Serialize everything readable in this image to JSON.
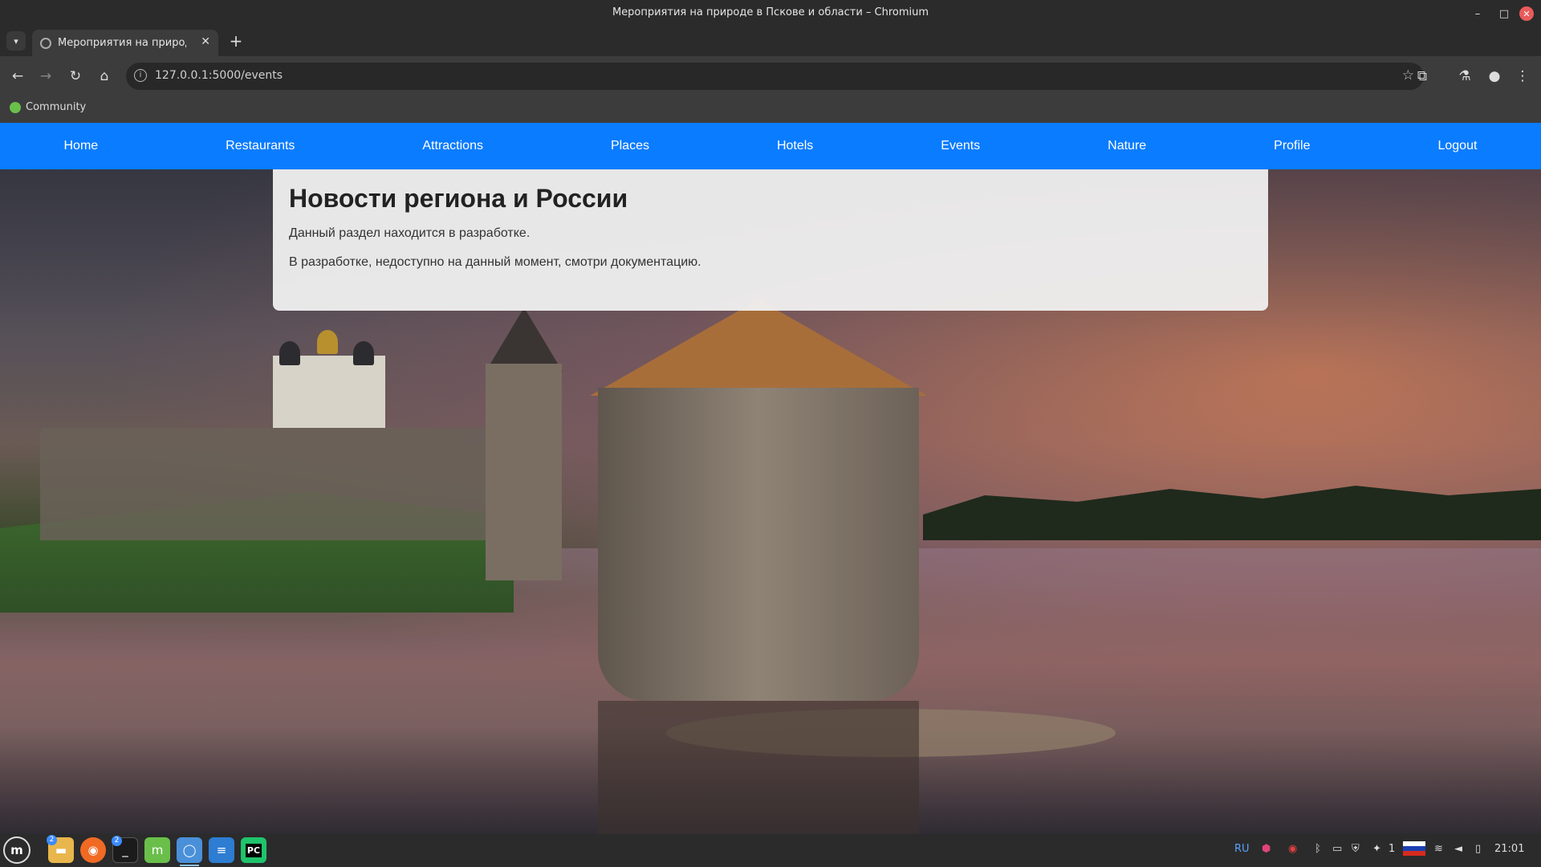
{
  "window": {
    "title": "Мероприятия на природе в Пскове и области – Chromium",
    "minimize": "–",
    "maximize": "□",
    "close": "✕"
  },
  "tabs": [
    {
      "title": "Мероприятия на природе в Пскове и области",
      "close": "✕"
    }
  ],
  "toolbar": {
    "url": "127.0.0.1:5000/events"
  },
  "bookmarks": [
    {
      "label": "Community"
    }
  ],
  "site_nav": {
    "items": [
      "Home",
      "Restaurants",
      "Attractions",
      "Places",
      "Hotels",
      "Events",
      "Nature",
      "Profile",
      "Logout"
    ]
  },
  "content": {
    "heading": "Новости региона и России",
    "paragraphs": [
      "Данный раздел находится в разработке.",
      "В разработке, недоступно на данный момент, смотри документацию."
    ]
  },
  "taskbar": {
    "badges": [
      "2",
      "2"
    ],
    "keyboard_layout": "RU",
    "notification_count": "1",
    "clock": "21:01"
  },
  "colors": {
    "nav_bg": "#0a7cff",
    "nav_text": "#ffffff",
    "card_bg": "#f0f0f0"
  }
}
